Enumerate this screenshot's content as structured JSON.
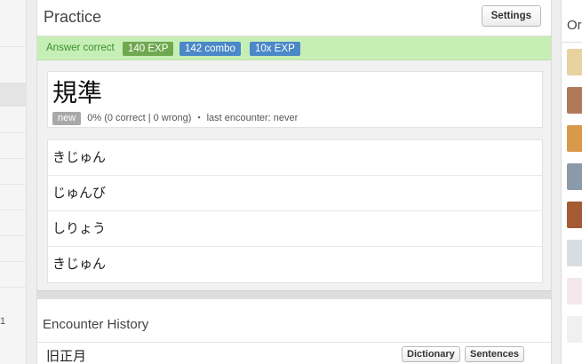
{
  "practice": {
    "title": "Practice",
    "settings_label": "Settings"
  },
  "result": {
    "message": "Answer correct",
    "exp": "140 EXP",
    "combo": "142 combo",
    "multiplier": "10x EXP"
  },
  "card": {
    "kanji": "規準",
    "status": "new",
    "stats": "0% (0 correct | 0 wrong)",
    "separator": "・",
    "last_encounter": "last encounter: never"
  },
  "answers": [
    {
      "label": "きじゅん"
    },
    {
      "label": "じゅんび"
    },
    {
      "label": "しりょう"
    },
    {
      "label": "きじゅん"
    }
  ],
  "history": {
    "title": "Encounter History",
    "word": "旧正月",
    "dictionary_label": "Dictionary",
    "sentences_label": "Sentences"
  },
  "online": {
    "title": "Or"
  },
  "left_panel": {
    "number": "1"
  },
  "colors": {
    "correct_bg": "#c6efb6",
    "exp_badge": "#6fa84f",
    "combo_badge": "#4a88c7",
    "new_tag": "#a9a9a9"
  },
  "icons": [
    "user-avatar-icon"
  ]
}
